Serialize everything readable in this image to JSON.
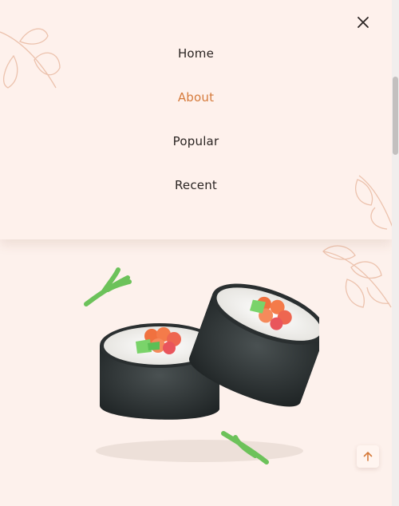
{
  "nav": {
    "items": [
      {
        "label": "Home"
      },
      {
        "label": "About"
      },
      {
        "label": "Popular"
      },
      {
        "label": "Recent"
      }
    ],
    "active_index": 1
  },
  "icons": {
    "close": "close-icon",
    "scroll_up": "arrow-up-icon"
  },
  "colors": {
    "background": "#fdf1ec",
    "active": "#d67b3c",
    "text": "#2b2523",
    "leaf": "#ecc2ad"
  }
}
